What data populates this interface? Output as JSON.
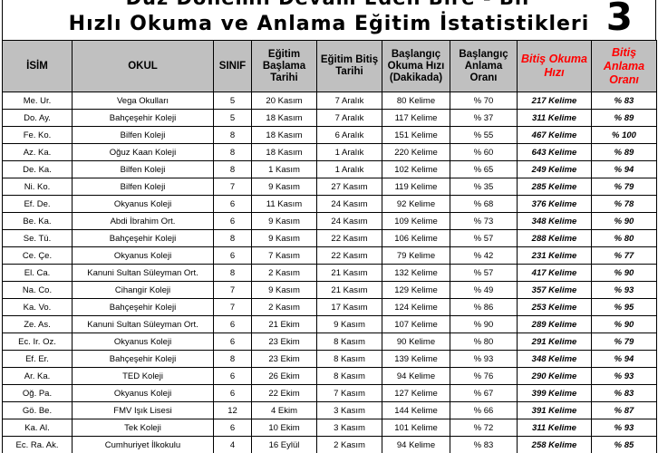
{
  "header": {
    "title_top": "Düz Dönemli Devam Eden Bire - Bir",
    "title_main": "Hızlı Okuma ve Anlama Eğitim İstatistikleri",
    "page_number": "3"
  },
  "columns": [
    {
      "label": "İSİM",
      "emphasis": false
    },
    {
      "label": "OKUL",
      "emphasis": false
    },
    {
      "label": "SINIF",
      "emphasis": false
    },
    {
      "label": "Eğitim Başlama Tarihi",
      "emphasis": false
    },
    {
      "label": "Eğitim Bitiş Tarihi",
      "emphasis": false
    },
    {
      "label": "Başlangıç Okuma Hızı (Dakikada)",
      "emphasis": false
    },
    {
      "label": "Başlangıç Anlama Oranı",
      "emphasis": false
    },
    {
      "label": "Bitiş Okuma Hızı",
      "emphasis": true
    },
    {
      "label": "Bitiş Anlama Oranı",
      "emphasis": true
    }
  ],
  "colors": {
    "header_bg": "#c0c0c0",
    "emphasis": "#ff0000"
  },
  "rows": [
    [
      "Me. Ur.",
      "Vega Okulları",
      "5",
      "20 Kasım",
      "7 Aralık",
      "80 Kelime",
      "% 70",
      "217 Kelime",
      "% 83"
    ],
    [
      "Do. Ay.",
      "Bahçeşehir Koleji",
      "5",
      "18 Kasım",
      "7 Aralık",
      "117 Kelime",
      "% 37",
      "311 Kelime",
      "% 89"
    ],
    [
      "Fe. Ko.",
      "Bilfen Koleji",
      "8",
      "18 Kasım",
      "6 Aralık",
      "151 Kelime",
      "% 55",
      "467 Kelime",
      "% 100"
    ],
    [
      "Az. Ka.",
      "Oğuz Kaan Koleji",
      "8",
      "18 Kasım",
      "1 Aralık",
      "220 Kelime",
      "% 60",
      "643 Kelime",
      "% 89"
    ],
    [
      "De. Ka.",
      "Bilfen Koleji",
      "8",
      "1 Kasım",
      "1 Aralık",
      "102 Kelime",
      "% 65",
      "249 Kelime",
      "% 94"
    ],
    [
      "Ni. Ko.",
      "Bilfen Koleji",
      "7",
      "9 Kasım",
      "27 Kasım",
      "119 Kelime",
      "% 35",
      "285 Kelime",
      "% 79"
    ],
    [
      "Ef. De.",
      "Okyanus Koleji",
      "6",
      "11 Kasım",
      "24 Kasım",
      "92 Kelime",
      "% 68",
      "376 Kelime",
      "% 78"
    ],
    [
      "Be. Ka.",
      "Abdi İbrahim Ort.",
      "6",
      "9 Kasım",
      "24 Kasım",
      "109 Kelime",
      "% 73",
      "348 Kelime",
      "% 90"
    ],
    [
      "Se. Tü.",
      "Bahçeşehir Koleji",
      "8",
      "9 Kasım",
      "22 Kasım",
      "106 Kelime",
      "% 57",
      "288 Kelime",
      "% 80"
    ],
    [
      "Ce. Çe.",
      "Okyanus Koleji",
      "6",
      "7 Kasım",
      "22 Kasım",
      "79 Kelime",
      "% 42",
      "231 Kelime",
      "% 77"
    ],
    [
      "El. Ca.",
      "Kanuni Sultan Süleyman Ort.",
      "8",
      "2 Kasım",
      "21 Kasım",
      "132 Kelime",
      "% 57",
      "417 Kelime",
      "% 90"
    ],
    [
      "Na. Co.",
      "Cihangir Koleji",
      "7",
      "9 Kasım",
      "21 Kasım",
      "129 Kelime",
      "% 49",
      "357 Kelime",
      "% 93"
    ],
    [
      "Ka. Vo.",
      "Bahçeşehir Koleji",
      "7",
      "2 Kasım",
      "17 Kasım",
      "124 Kelime",
      "% 86",
      "253 Kelime",
      "% 95"
    ],
    [
      "Ze. As.",
      "Kanuni Sultan Süleyman Ort.",
      "6",
      "21 Ekim",
      "9 Kasım",
      "107 Kelime",
      "% 90",
      "289 Kelime",
      "% 90"
    ],
    [
      "Ec. Ir. Oz.",
      "Okyanus Koleji",
      "6",
      "23 Ekim",
      "8 Kasım",
      "90 Kelime",
      "% 80",
      "291 Kelime",
      "% 79"
    ],
    [
      "Ef. Er.",
      "Bahçeşehir Koleji",
      "8",
      "23 Ekim",
      "8 Kasım",
      "139 Kelime",
      "% 93",
      "348 Kelime",
      "% 94"
    ],
    [
      "Ar. Ka.",
      "TED Koleji",
      "6",
      "26 Ekim",
      "8 Kasım",
      "94 Kelime",
      "% 76",
      "290 Kelime",
      "% 93"
    ],
    [
      "Oğ. Pa.",
      "Okyanus Koleji",
      "6",
      "22 Ekim",
      "7 Kasım",
      "127 Kelime",
      "% 67",
      "399 Kelime",
      "% 83"
    ],
    [
      "Gö. Be.",
      "FMV Işık Lisesi",
      "12",
      "4 Ekim",
      "3 Kasım",
      "144 Kelime",
      "% 66",
      "391 Kelime",
      "% 87"
    ],
    [
      "Ka. Al.",
      "Tek Koleji",
      "6",
      "10 Ekim",
      "3 Kasım",
      "101 Kelime",
      "% 72",
      "311 Kelime",
      "% 93"
    ],
    [
      "Ec. Ra. Ak.",
      "Cumhuriyet İlkokulu",
      "4",
      "16 Eylül",
      "2 Kasım",
      "94 Kelime",
      "% 83",
      "258 Kelime",
      "% 85"
    ]
  ]
}
